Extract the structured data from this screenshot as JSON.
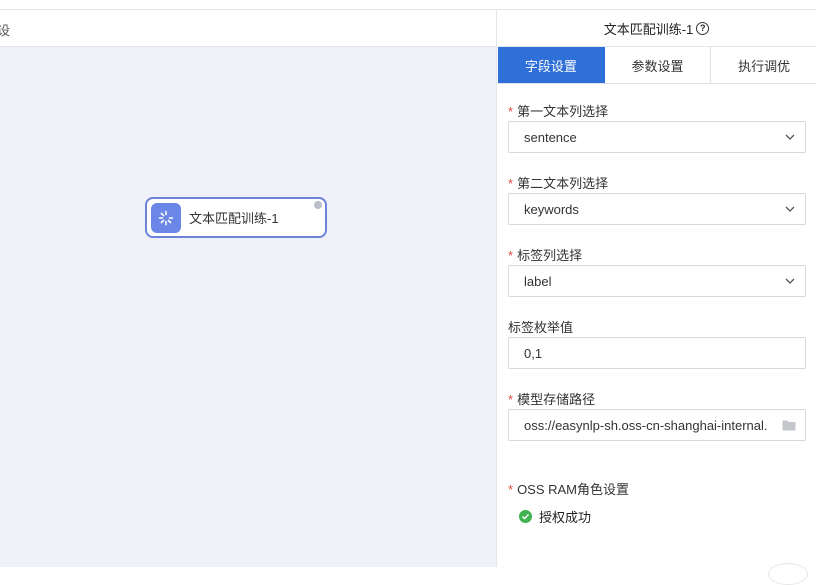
{
  "canvas": {
    "header_edge_text": "设",
    "node": {
      "label": "文本匹配训练-1"
    }
  },
  "panel": {
    "title": "文本匹配训练-1",
    "help_symbol": "?",
    "tabs": [
      {
        "label": "字段设置",
        "active": true
      },
      {
        "label": "参数设置",
        "active": false
      },
      {
        "label": "执行调优",
        "active": false
      }
    ],
    "fields": [
      {
        "label": "第一文本列选择",
        "required": true,
        "value": "sentence",
        "type": "select"
      },
      {
        "label": "第二文本列选择",
        "required": true,
        "value": "keywords",
        "type": "select"
      },
      {
        "label": "标签列选择",
        "required": true,
        "value": "label",
        "type": "select"
      },
      {
        "label": "标签枚举值",
        "required": false,
        "value": "0,1",
        "type": "input"
      },
      {
        "label": "模型存储路径",
        "required": true,
        "value": "oss://easynlp-sh.oss-cn-shanghai-internal.",
        "type": "path"
      }
    ],
    "oss_role": {
      "label": "OSS RAM角色设置",
      "required": true,
      "status": "授权成功"
    },
    "required_mark": "*"
  },
  "colors": {
    "accent": "#2e6fd8",
    "node_border": "#6d83d8",
    "node_icon": "#6b86e6",
    "success": "#3fb34f",
    "required": "#e04a3f",
    "canvas_bg": "#eef1f8"
  },
  "icons": {
    "node": "loading-spinner-icon",
    "help": "question-circle-icon",
    "dropdown": "chevron-down-icon",
    "folder": "folder-icon",
    "success": "check-circle-icon"
  }
}
